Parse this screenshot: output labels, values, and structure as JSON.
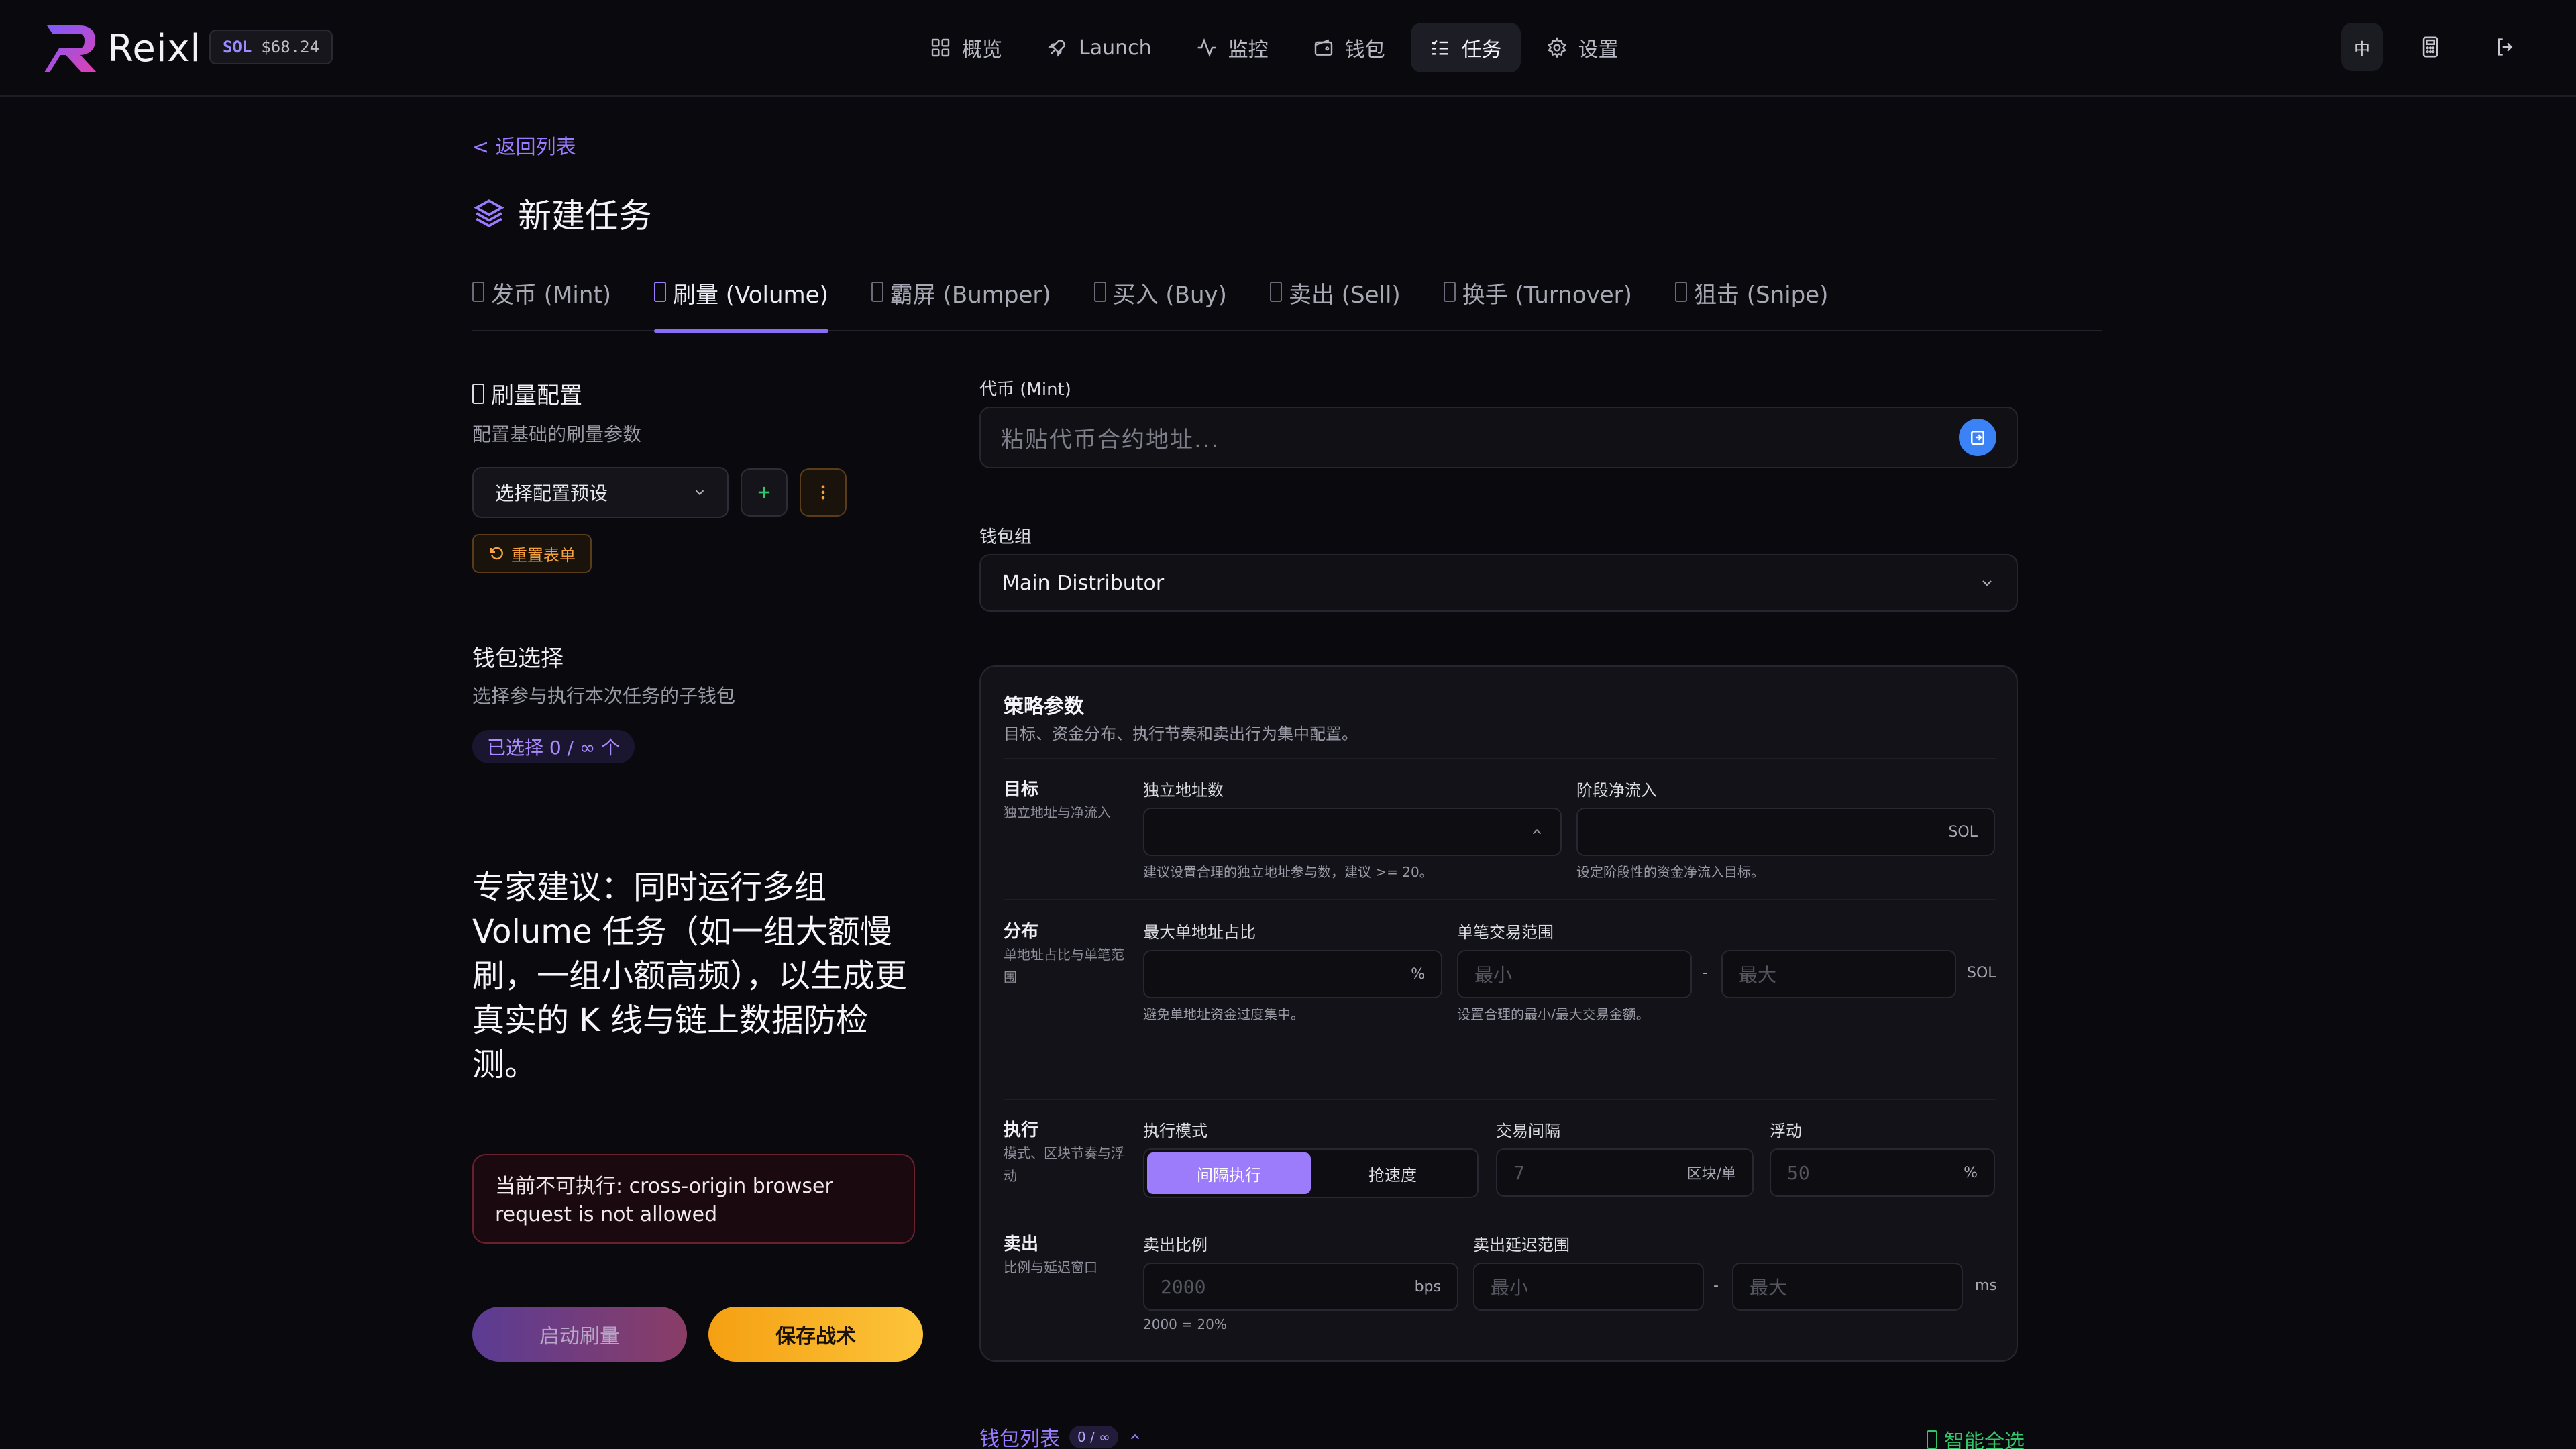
{
  "app": {
    "name": "Reixl",
    "sol_tag": "SOL",
    "sol_price": "$68.24",
    "accent": "#8b6cf5"
  },
  "nav": {
    "items": [
      {
        "label": "概览",
        "icon": "grid-icon"
      },
      {
        "label": "Launch",
        "icon": "rocket-icon"
      },
      {
        "label": "监控",
        "icon": "activity-icon"
      },
      {
        "label": "钱包",
        "icon": "wallet-icon"
      },
      {
        "label": "任务",
        "icon": "list-checks-icon",
        "active": true
      },
      {
        "label": "设置",
        "icon": "gear-icon"
      }
    ],
    "lang": "中"
  },
  "page": {
    "back": "< 返回列表",
    "title": "新建任务"
  },
  "tabs": [
    {
      "label": "发币 (Mint)"
    },
    {
      "label": "刷量 (Volume)",
      "active": true
    },
    {
      "label": "霸屏 (Bumper)"
    },
    {
      "label": "买入 (Buy)"
    },
    {
      "label": "卖出 (Sell)"
    },
    {
      "label": "换手 (Turnover)"
    },
    {
      "label": "狙击 (Snipe)"
    }
  ],
  "config": {
    "title": "刷量配置",
    "subtitle": "配置基础的刷量参数",
    "preset_placeholder": "选择配置预设",
    "reset": "重置表单"
  },
  "wallet_select": {
    "title": "钱包选择",
    "subtitle": "选择参与执行本次任务的子钱包",
    "selected": "已选择 0 / ∞ 个"
  },
  "advice": "专家建议：同时运行多组 Volume 任务（如一组大额慢刷，一组小额高频），以生成更真实的 K 线与链上数据防检测。",
  "error": "当前不可执行: cross-origin browser request is not allowed",
  "actions": {
    "start": "启动刷量",
    "save": "保存战术"
  },
  "mint": {
    "label": "代币 (Mint)",
    "placeholder": "粘贴代币合约地址..."
  },
  "wallet_group": {
    "label": "钱包组",
    "value": "Main Distributor"
  },
  "strategy": {
    "title": "策略参数",
    "subtitle": "目标、资金分布、执行节奏和卖出行为集中配置。",
    "target": {
      "title": "目标",
      "subtitle": "独立地址与净流入",
      "unique_label": "独立地址数",
      "unique_hint": "建议设置合理的独立地址参与数，建议 >= 20。",
      "inflow_label": "阶段净流入",
      "inflow_unit": "SOL",
      "inflow_hint": "设定阶段性的资金净流入目标。"
    },
    "distribution": {
      "title": "分布",
      "subtitle": "单地址占比与单笔范围",
      "max_share_label": "最大单地址占比",
      "max_share_unit": "%",
      "max_share_hint": "避免单地址资金过度集中。",
      "range_label": "单笔交易范围",
      "min_ph": "最小",
      "max_ph": "最大",
      "dash": "-",
      "range_unit": "SOL",
      "range_hint": "设置合理的最小/最大交易金额。"
    },
    "execution": {
      "title": "执行",
      "subtitle": "模式、区块节奏与浮动",
      "mode_label": "执行模式",
      "mode_interval": "间隔执行",
      "mode_fast": "抢速度",
      "interval_label": "交易间隔",
      "interval_ph": "7",
      "interval_unit": "区块/单",
      "float_label": "浮动",
      "float_ph": "50",
      "float_unit": "%"
    },
    "sell": {
      "title": "卖出",
      "subtitle": "比例与延迟窗口",
      "ratio_label": "卖出比例",
      "ratio_ph": "2000",
      "ratio_unit": "bps",
      "ratio_hint": "2000 = 20%",
      "delay_label": "卖出延迟范围",
      "min_ph": "最小",
      "max_ph": "最大",
      "dash": "-",
      "delay_unit": "ms"
    }
  },
  "wallet_list": {
    "label": "钱包列表",
    "count": "0 / ∞",
    "smart_select": "智能全选"
  }
}
